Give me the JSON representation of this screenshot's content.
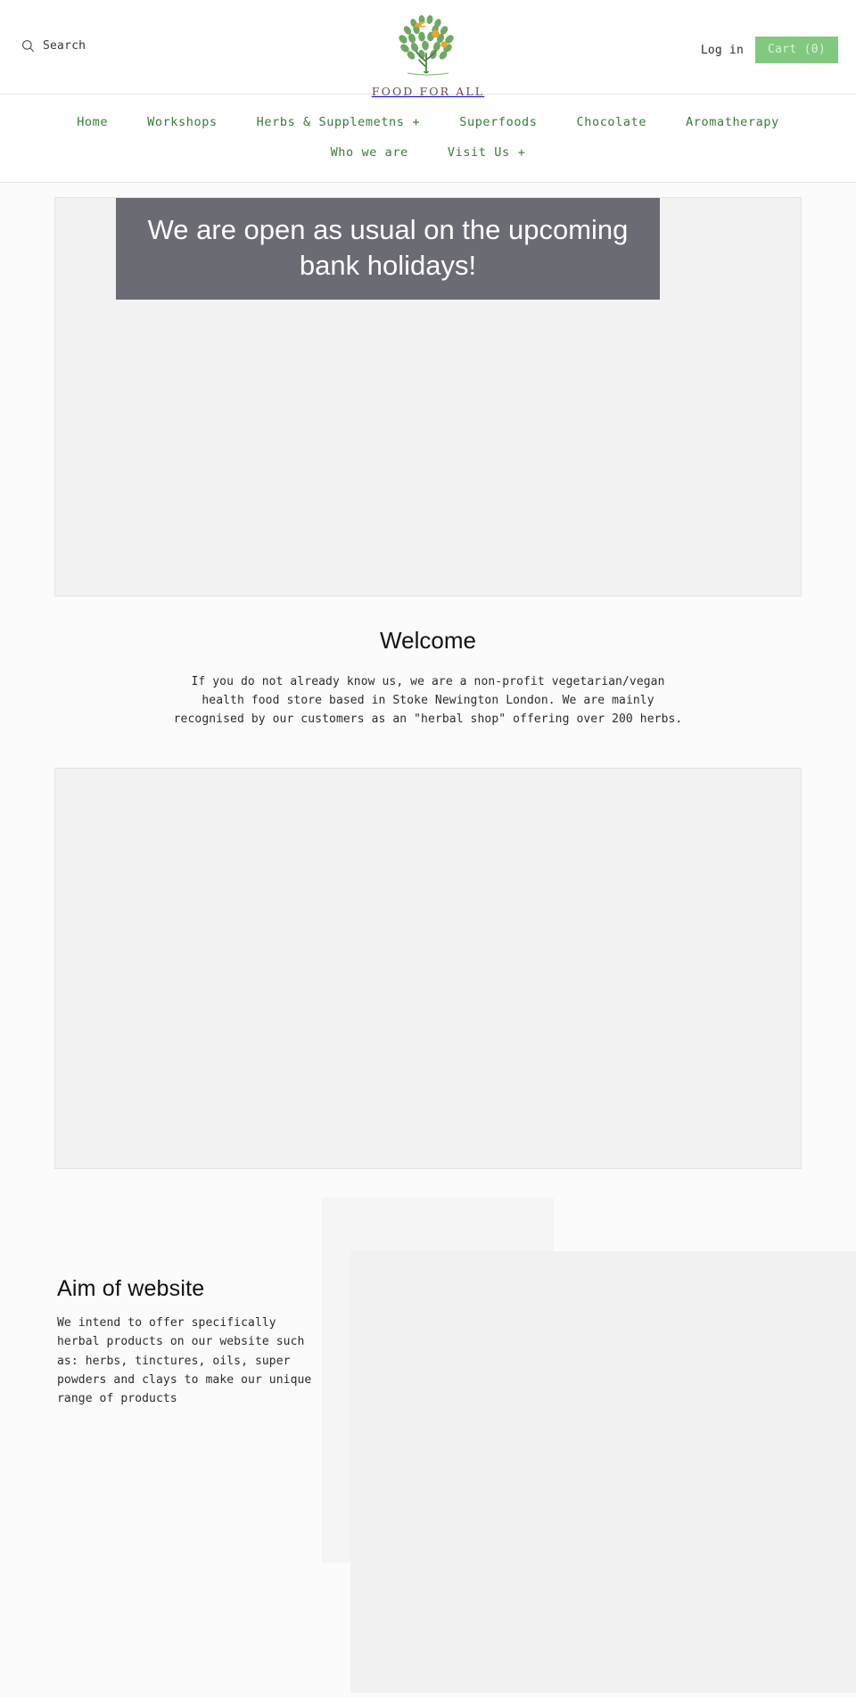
{
  "header": {
    "search": {
      "label": "Search",
      "icon": "search-icon"
    },
    "brand": {
      "name": "FOOD FOR ALL",
      "logo_icon": "tree-logo-icon"
    },
    "login_label": "Log in",
    "cart_label": "Cart (0)",
    "cart_bg_color": "#81c97e",
    "cart_text_color": "#ddf1dc"
  },
  "nav": {
    "accent_color": "#3c7a3c",
    "rows": [
      [
        {
          "label": "Home",
          "has_plus": false
        },
        {
          "label": "Workshops",
          "has_plus": false
        },
        {
          "label": "Herbs & Supplemetns",
          "has_plus": true
        },
        {
          "label": "Superfoods",
          "has_plus": false
        },
        {
          "label": "Chocolate",
          "has_plus": false
        },
        {
          "label": "Aromatherapy",
          "has_plus": false
        }
      ],
      [
        {
          "label": "Who we are",
          "has_plus": false
        },
        {
          "label": "Visit Us",
          "has_plus": true
        }
      ]
    ]
  },
  "hero": {
    "title": "We are open as usual on the upcoming bank holidays!",
    "overlay_color": "#6b6b74",
    "title_color": "#ffffff"
  },
  "welcome": {
    "title": "Welcome",
    "body": "If you do not already know us, we are a non-profit vegetarian/vegan health food store based in Stoke Newington London. We are mainly recognised by our customers as an \"herbal shop\" offering over 200 herbs."
  },
  "aim": {
    "title": "Aim of website",
    "body": "We intend to offer specifically herbal products on our website such as: herbs, tinctures, oils, super powders and clays to make our unique range of products"
  },
  "plus_glyph": "+"
}
